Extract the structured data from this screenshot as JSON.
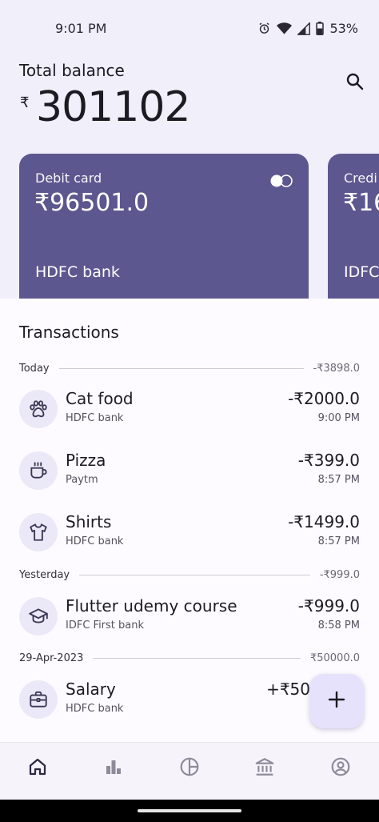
{
  "status_bar": {
    "time": "9:01 PM",
    "battery": "53%"
  },
  "header": {
    "balance_label": "Total balance",
    "currency_symbol": "₹",
    "balance_amount": "301102"
  },
  "cards": [
    {
      "label": "Debit card",
      "amount": "₹96501.0",
      "bank": "HDFC bank"
    },
    {
      "label": "Credi",
      "amount": "₹16",
      "bank": "IDFC"
    }
  ],
  "transactions": {
    "title": "Transactions",
    "groups": [
      {
        "label": "Today",
        "total": "-₹3898.0",
        "items": [
          {
            "icon": "paw-icon",
            "title": "Cat food",
            "bank": "HDFC bank",
            "amount": "-₹2000.0",
            "time": "9:00 PM"
          },
          {
            "icon": "coffee-cup-icon",
            "title": "Pizza",
            "bank": "Paytm",
            "amount": "-₹399.0",
            "time": "8:57 PM"
          },
          {
            "icon": "shirt-icon",
            "title": "Shirts",
            "bank": "HDFC bank",
            "amount": "-₹1499.0",
            "time": "8:57 PM"
          }
        ]
      },
      {
        "label": "Yesterday",
        "total": "-₹999.0",
        "items": [
          {
            "icon": "graduation-cap-icon",
            "title": "Flutter udemy course",
            "bank": "IDFC First bank",
            "amount": "-₹999.0",
            "time": "8:58 PM"
          }
        ]
      },
      {
        "label": "29-Apr-2023",
        "total": "₹50000.0",
        "items": [
          {
            "icon": "briefcase-icon",
            "title": "Salary",
            "bank": "HDFC bank",
            "amount": "+₹50",
            "time": ""
          }
        ]
      }
    ]
  },
  "nav": [
    {
      "icon": "home-icon",
      "active": true
    },
    {
      "icon": "bar-chart-icon",
      "active": false
    },
    {
      "icon": "pie-chart-icon",
      "active": false
    },
    {
      "icon": "bank-icon",
      "active": false
    },
    {
      "icon": "profile-icon",
      "active": false
    }
  ],
  "colors": {
    "background": "#f1eff9",
    "card": "#5d5790",
    "accent_icon_bg": "#ebe8f7",
    "fab": "#e6e2fb"
  }
}
